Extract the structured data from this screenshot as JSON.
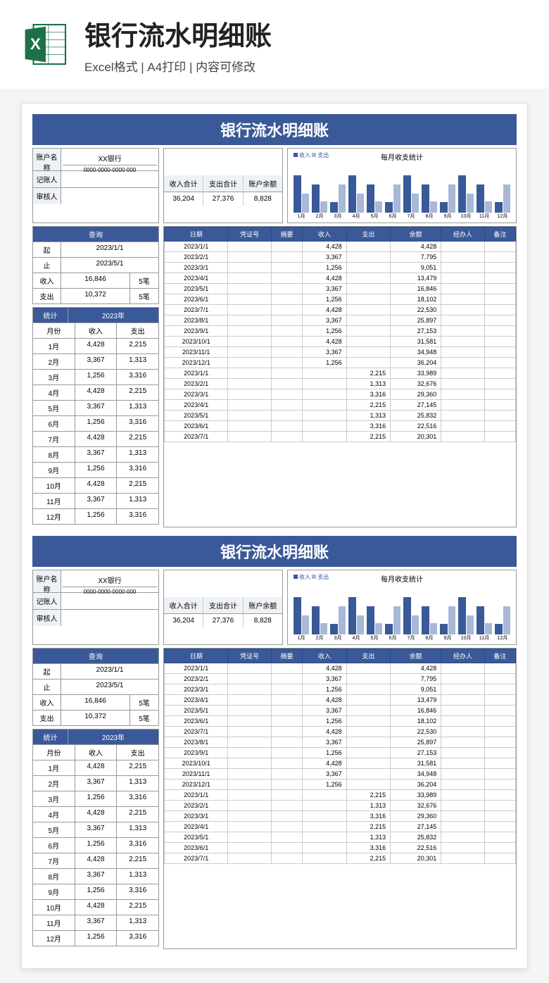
{
  "header": {
    "title": "银行流水明细账",
    "subtitle": "Excel格式 | A4打印 | 内容可修改",
    "icon_label": "X"
  },
  "sheet": {
    "title": "银行流水明细账",
    "account": {
      "label_name": "账户名称",
      "bank": "XX银行",
      "number": "0000-0000-0000-000",
      "label_recorder": "记账人",
      "recorder": "",
      "label_auditor": "审核人",
      "auditor": ""
    },
    "totals": {
      "income_label": "收入合计",
      "expense_label": "支出合计",
      "balance_label": "账户余额",
      "income": "36,204",
      "expense": "27,376",
      "balance": "8,828"
    },
    "chart_title": "每月收支统计",
    "legend_in": "收入",
    "legend_out": "支出",
    "query": {
      "title": "查询",
      "from_label": "起",
      "from": "2023/1/1",
      "to_label": "止",
      "to": "2023/5/1",
      "income_label": "收入",
      "income_val": "16,846",
      "income_cnt": "5笔",
      "expense_label": "支出",
      "expense_val": "10,372",
      "expense_cnt": "5笔"
    },
    "stats": {
      "title": "统计",
      "year": "2023年",
      "col_month": "月份",
      "col_in": "收入",
      "col_out": "支出",
      "rows": [
        {
          "m": "1月",
          "in": "4,428",
          "out": "2,215"
        },
        {
          "m": "2月",
          "in": "3,367",
          "out": "1,313"
        },
        {
          "m": "3月",
          "in": "1,256",
          "out": "3,316"
        },
        {
          "m": "4月",
          "in": "4,428",
          "out": "2,215"
        },
        {
          "m": "5月",
          "in": "3,367",
          "out": "1,313"
        },
        {
          "m": "6月",
          "in": "1,256",
          "out": "3,316"
        },
        {
          "m": "7月",
          "in": "4,428",
          "out": "2,215"
        },
        {
          "m": "8月",
          "in": "3,367",
          "out": "1,313"
        },
        {
          "m": "9月",
          "in": "1,256",
          "out": "3,316"
        },
        {
          "m": "10月",
          "in": "4,428",
          "out": "2,215"
        },
        {
          "m": "11月",
          "in": "3,367",
          "out": "1,313"
        },
        {
          "m": "12月",
          "in": "1,256",
          "out": "3,316"
        }
      ]
    },
    "table": {
      "headers": [
        "日期",
        "凭证号",
        "摘要",
        "收入",
        "支出",
        "余额",
        "经办人",
        "备注"
      ],
      "rows": [
        {
          "date": "2023/1/1",
          "in": "4,428",
          "out": "",
          "bal": "4,428"
        },
        {
          "date": "2023/2/1",
          "in": "3,367",
          "out": "",
          "bal": "7,795"
        },
        {
          "date": "2023/3/1",
          "in": "1,256",
          "out": "",
          "bal": "9,051"
        },
        {
          "date": "2023/4/1",
          "in": "4,428",
          "out": "",
          "bal": "13,479"
        },
        {
          "date": "2023/5/1",
          "in": "3,367",
          "out": "",
          "bal": "16,846"
        },
        {
          "date": "2023/6/1",
          "in": "1,256",
          "out": "",
          "bal": "18,102"
        },
        {
          "date": "2023/7/1",
          "in": "4,428",
          "out": "",
          "bal": "22,530"
        },
        {
          "date": "2023/8/1",
          "in": "3,367",
          "out": "",
          "bal": "25,897"
        },
        {
          "date": "2023/9/1",
          "in": "1,256",
          "out": "",
          "bal": "27,153"
        },
        {
          "date": "2023/10/1",
          "in": "4,428",
          "out": "",
          "bal": "31,581"
        },
        {
          "date": "2023/11/1",
          "in": "3,367",
          "out": "",
          "bal": "34,948"
        },
        {
          "date": "2023/12/1",
          "in": "1,256",
          "out": "",
          "bal": "36,204"
        },
        {
          "date": "2023/1/1",
          "in": "",
          "out": "2,215",
          "bal": "33,989"
        },
        {
          "date": "2023/2/1",
          "in": "",
          "out": "1,313",
          "bal": "32,676"
        },
        {
          "date": "2023/3/1",
          "in": "",
          "out": "3,316",
          "bal": "29,360"
        },
        {
          "date": "2023/4/1",
          "in": "",
          "out": "2,215",
          "bal": "27,145"
        },
        {
          "date": "2023/5/1",
          "in": "",
          "out": "1,313",
          "bal": "25,832"
        },
        {
          "date": "2023/6/1",
          "in": "",
          "out": "3,316",
          "bal": "22,516"
        },
        {
          "date": "2023/7/1",
          "in": "",
          "out": "2,215",
          "bal": "20,301"
        }
      ]
    }
  },
  "chart_data": {
    "type": "bar",
    "title": "每月收支统计",
    "categories": [
      "1月",
      "2月",
      "3月",
      "4月",
      "5月",
      "6月",
      "7月",
      "8月",
      "9月",
      "10月",
      "11月",
      "12月"
    ],
    "series": [
      {
        "name": "收入",
        "values": [
          4428,
          3367,
          1256,
          4428,
          3367,
          1256,
          4428,
          3367,
          1256,
          4428,
          3367,
          1256
        ]
      },
      {
        "name": "支出",
        "values": [
          2215,
          1313,
          3316,
          2215,
          1313,
          3316,
          2215,
          1313,
          3316,
          2215,
          1313,
          3316
        ]
      }
    ],
    "ylim": [
      0,
      5000
    ],
    "yticks": [
      0,
      1000,
      2000,
      3000,
      4000,
      5000
    ]
  }
}
